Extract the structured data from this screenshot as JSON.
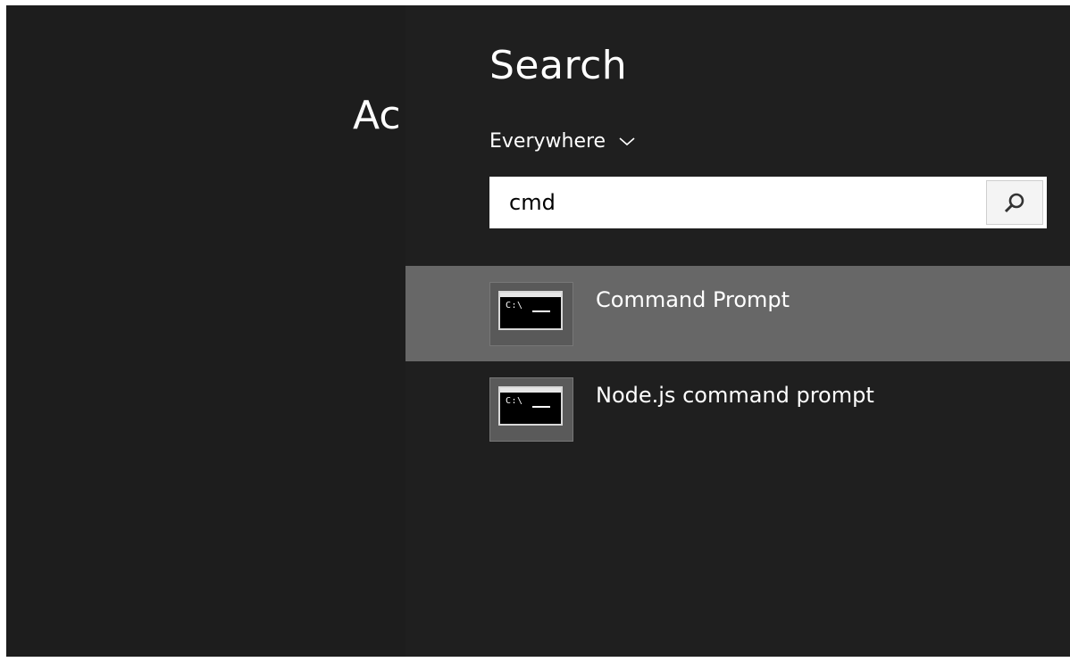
{
  "background": {
    "partial_text": "Ac"
  },
  "search_pane": {
    "title": "Search",
    "scope": {
      "label": "Everywhere",
      "icon": "chevron-down-icon"
    },
    "search_box": {
      "value": "cmd",
      "button_icon": "search-icon"
    },
    "results": [
      {
        "label": "Command Prompt",
        "icon": "command-prompt-icon",
        "selected": true
      },
      {
        "label": "Node.js command prompt",
        "icon": "command-prompt-icon",
        "selected": false
      }
    ]
  },
  "colors": {
    "screen_background": "#1d1d1d",
    "selected_result": "#676767",
    "text": "#ffffff"
  }
}
